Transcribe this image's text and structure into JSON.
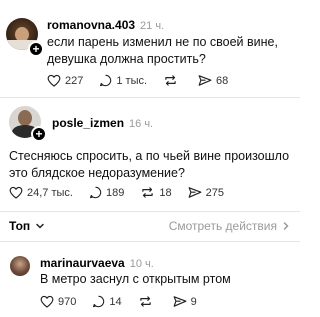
{
  "posts": [
    {
      "username": "romanovna.403",
      "time": "21 ч.",
      "text_lines": [
        "если парень изменил не по своей вине,",
        "девушка должна простить?"
      ],
      "likes": "227",
      "replies": "1 тыс.",
      "reposts": "",
      "shares": "68"
    },
    {
      "username": "posle_izmen",
      "time": "16 ч.",
      "text_lines": [
        "Стесняюсь спросить, а по чьей вине произошло",
        "это блядское недоразумение?"
      ],
      "likes": "24,7 тыс.",
      "replies": "189",
      "reposts": "18",
      "shares": "275"
    },
    {
      "username": "marinaurvaeva",
      "time": "10 ч.",
      "text_lines": [
        "В метро заснул с открытым ртом"
      ],
      "likes": "970",
      "replies": "14",
      "reposts": "",
      "shares": "9"
    }
  ],
  "sort": {
    "label": "Топ",
    "view_actions": "Смотреть действия"
  },
  "icons": [
    "heart-icon",
    "comment-icon",
    "repost-icon",
    "share-icon",
    "chevron-down-icon",
    "chevron-right-icon",
    "plus-icon"
  ]
}
